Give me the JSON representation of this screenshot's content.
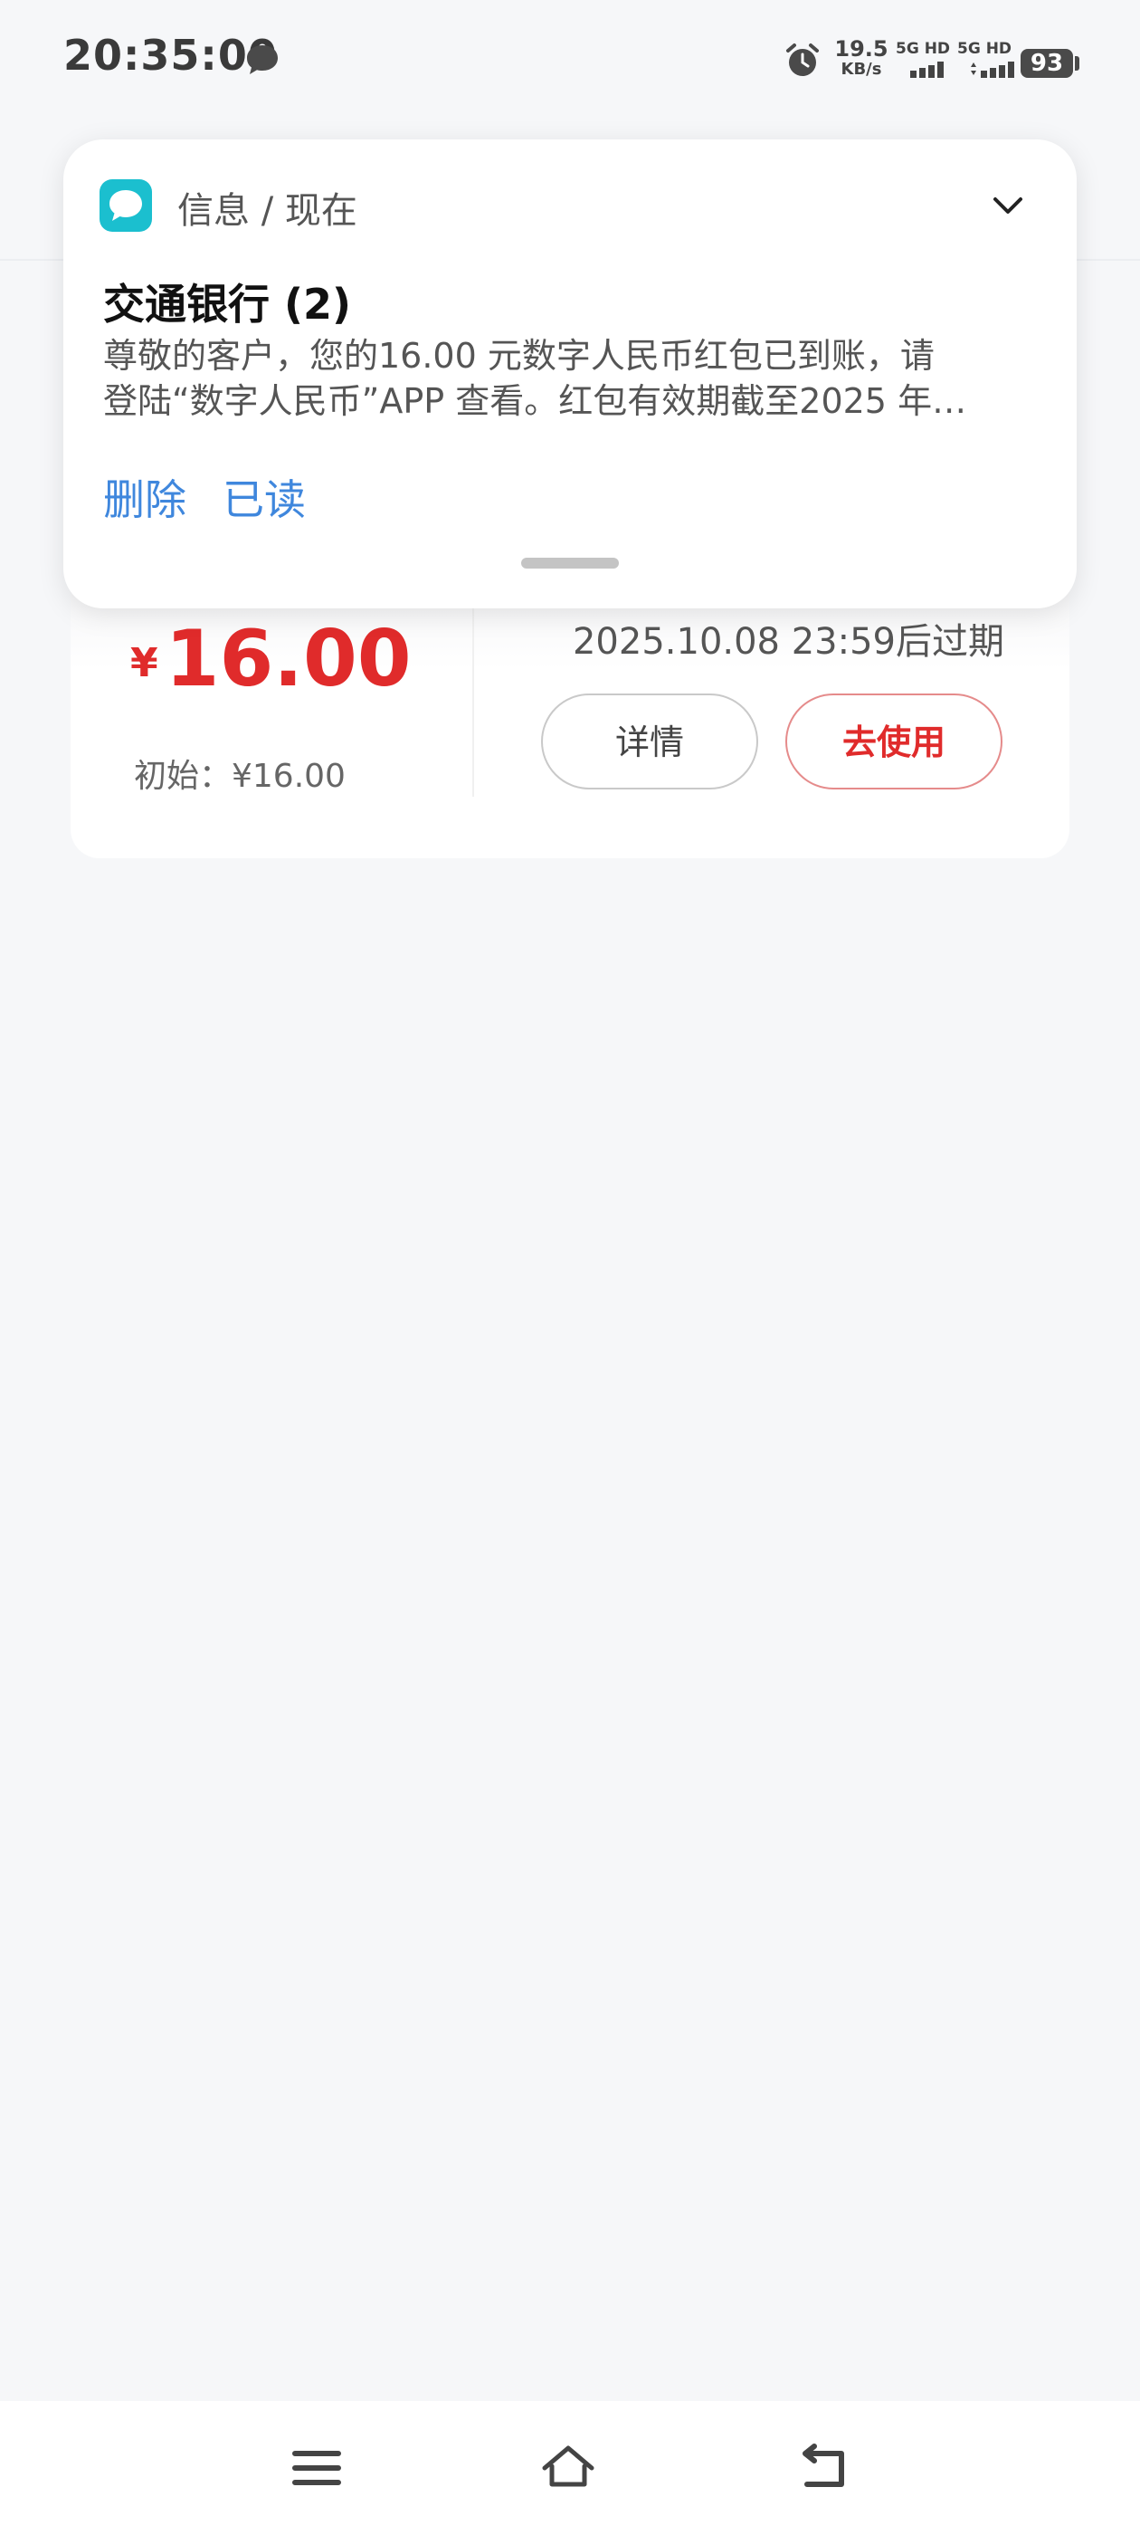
{
  "status_bar": {
    "time": "20:35:00",
    "net_speed_value": "19.5",
    "net_speed_unit": "KB/s",
    "sim1_label": "5G HD",
    "sim2_label": "5G HD",
    "battery": "93",
    "icons": [
      "chat-bubble-icon",
      "alarm-icon",
      "signal-icon",
      "battery-icon"
    ]
  },
  "notification": {
    "app_label": "信息 / 现在",
    "title": "交通银行 (2)",
    "body_line1": "尊敬的客户，您的16.00 元数字人民币红包已到账，请",
    "body_line2": "登陆“数字人民币”APP 查看。红包有效期截至2025 年…",
    "actions": {
      "delete": "删除",
      "read": "已读"
    },
    "icon_color": "#1bbfcf",
    "action_color": "#3f87dd"
  },
  "red_packet": {
    "currency": "¥",
    "amount": "16.00",
    "initial": "初始：¥16.00",
    "expiry": "2025.10.08 23:59后过期",
    "detail_button": "详情",
    "use_button": "去使用",
    "accent_color": "#e02b2b"
  },
  "nav_bar": {
    "icons": [
      "menu-icon",
      "home-icon",
      "back-icon"
    ]
  }
}
